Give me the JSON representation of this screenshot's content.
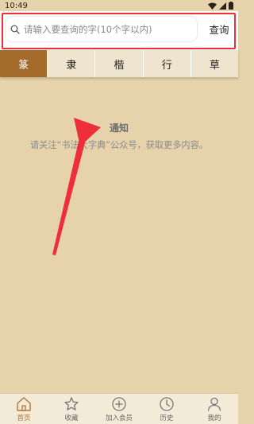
{
  "status_bar": {
    "time": "10:49"
  },
  "search": {
    "placeholder": "请输入要查询的字(10个字以内)",
    "value": "",
    "button_label": "查询"
  },
  "style_tabs": [
    {
      "label": "篆",
      "active": true
    },
    {
      "label": "隶",
      "active": false
    },
    {
      "label": "楷",
      "active": false
    },
    {
      "label": "行",
      "active": false
    },
    {
      "label": "草",
      "active": false
    }
  ],
  "notice": {
    "title": "通知",
    "body": "请关注“书法大字典”公众号，获取更多内容。"
  },
  "bottom_nav": [
    {
      "label": "首页",
      "icon": "home-icon",
      "active": true
    },
    {
      "label": "收藏",
      "icon": "star-icon",
      "active": false
    },
    {
      "label": "加入会员",
      "icon": "plus-circle-icon",
      "active": false
    },
    {
      "label": "历史",
      "icon": "clock-icon",
      "active": false
    },
    {
      "label": "我的",
      "icon": "person-icon",
      "active": false
    }
  ],
  "colors": {
    "background": "#e6d3ab",
    "tab_active": "#a46a2a",
    "tab_inactive": "#efe4cd",
    "highlight_red": "#ee2e3a",
    "nav_active": "#b77432"
  }
}
